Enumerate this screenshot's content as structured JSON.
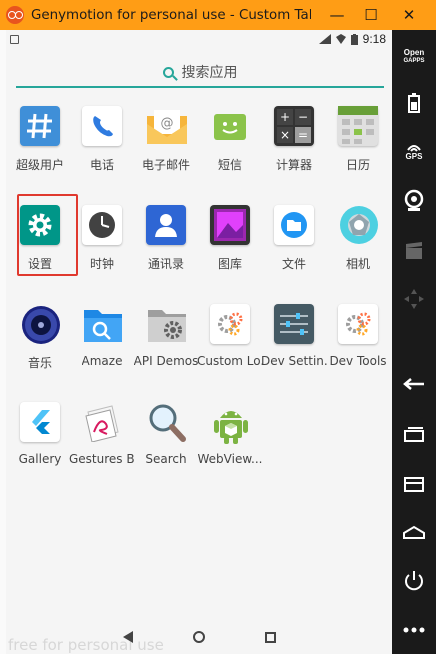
{
  "window": {
    "title": "Genymotion for personal use - Custom Tabl...",
    "minimize": "—",
    "maximize": "☐",
    "close": "✕"
  },
  "statusbar": {
    "time": "9:18"
  },
  "search": {
    "label": "搜索应用"
  },
  "apps": [
    {
      "label": "超级用户",
      "icon": "superuser-icon"
    },
    {
      "label": "电话",
      "icon": "phone-icon"
    },
    {
      "label": "电子邮件",
      "icon": "email-icon"
    },
    {
      "label": "短信",
      "icon": "sms-icon"
    },
    {
      "label": "计算器",
      "icon": "calculator-icon"
    },
    {
      "label": "日历",
      "icon": "calendar-icon"
    },
    {
      "label": "设置",
      "icon": "settings-icon"
    },
    {
      "label": "时钟",
      "icon": "clock-icon"
    },
    {
      "label": "通讯录",
      "icon": "contacts-icon"
    },
    {
      "label": "图库",
      "icon": "gallery-icon"
    },
    {
      "label": "文件",
      "icon": "files-icon"
    },
    {
      "label": "相机",
      "icon": "camera-icon"
    },
    {
      "label": "音乐",
      "icon": "music-icon"
    },
    {
      "label": "Amaze",
      "icon": "amaze-folder-icon"
    },
    {
      "label": "API Demos",
      "icon": "api-demos-icon"
    },
    {
      "label": "Custom Lo...",
      "icon": "custom-locale-icon"
    },
    {
      "label": "Dev Settin...",
      "icon": "dev-settings-icon"
    },
    {
      "label": "Dev Tools",
      "icon": "dev-tools-icon"
    },
    {
      "label": "Gallery",
      "icon": "flutter-gallery-icon"
    },
    {
      "label": "Gestures B...",
      "icon": "gestures-builder-icon"
    },
    {
      "label": "Search",
      "icon": "search-app-icon"
    },
    {
      "label": "WebView...",
      "icon": "webview-android-icon"
    }
  ],
  "watermark": "free for personal use",
  "sidebar": {
    "opengapps_line1": "Open",
    "opengapps_line2": "GAPPS",
    "gps": "GPS"
  },
  "colors": {
    "titlebar": "#ff9d15",
    "accent": "#26a69a",
    "selection": "#e0392e",
    "sidebar": "#1a1a1a"
  }
}
